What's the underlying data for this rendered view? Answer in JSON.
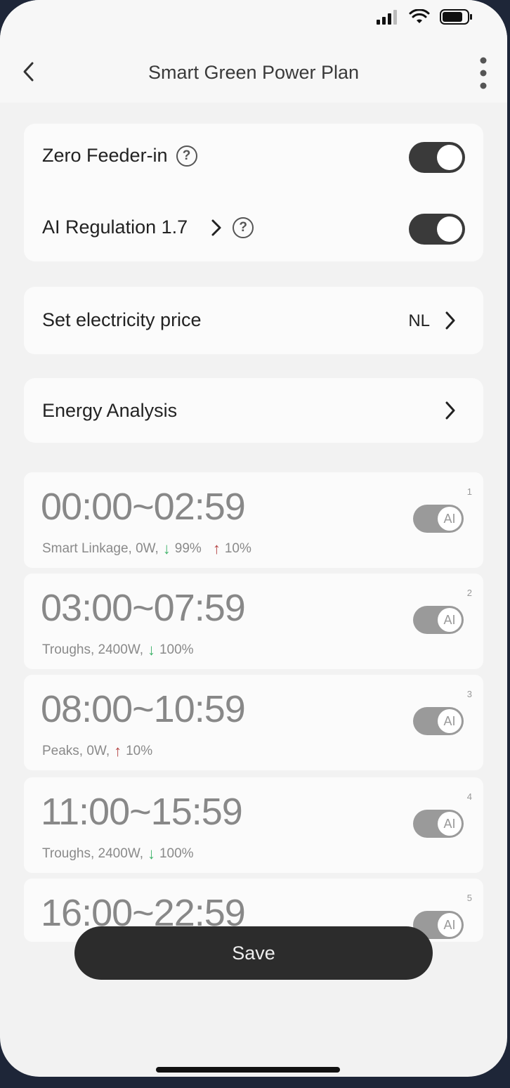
{
  "header": {
    "title": "Smart Green Power Plan"
  },
  "settings": {
    "zero_feeder": {
      "label": "Zero Feeder-in",
      "help": "?",
      "enabled": true
    },
    "ai_regulation": {
      "label": "AI Regulation 1.7",
      "help": "?",
      "enabled": true
    }
  },
  "electricity_price": {
    "label": "Set electricity price",
    "value": "NL"
  },
  "energy_analysis": {
    "label": "Energy Analysis"
  },
  "slots": [
    {
      "index": "1",
      "time": "00:00~02:59",
      "desc": "Smart Linkage, 0W,",
      "down": "99%",
      "up": "10%",
      "ai": "AI"
    },
    {
      "index": "2",
      "time": "03:00~07:59",
      "desc": "Troughs, 2400W,",
      "down": "100%",
      "ai": "AI"
    },
    {
      "index": "3",
      "time": "08:00~10:59",
      "desc": "Peaks, 0W,",
      "up": "10%",
      "ai": "AI"
    },
    {
      "index": "4",
      "time": "11:00~15:59",
      "desc": "Troughs, 2400W,",
      "down": "100%",
      "ai": "AI"
    },
    {
      "index": "5",
      "time": "16:00~22:59",
      "ai": "AI"
    }
  ],
  "save_label": "Save",
  "colors": {
    "down_arrow": "#3fb36a",
    "up_arrow": "#b54545",
    "toggle_on": "#3a3a3a"
  }
}
